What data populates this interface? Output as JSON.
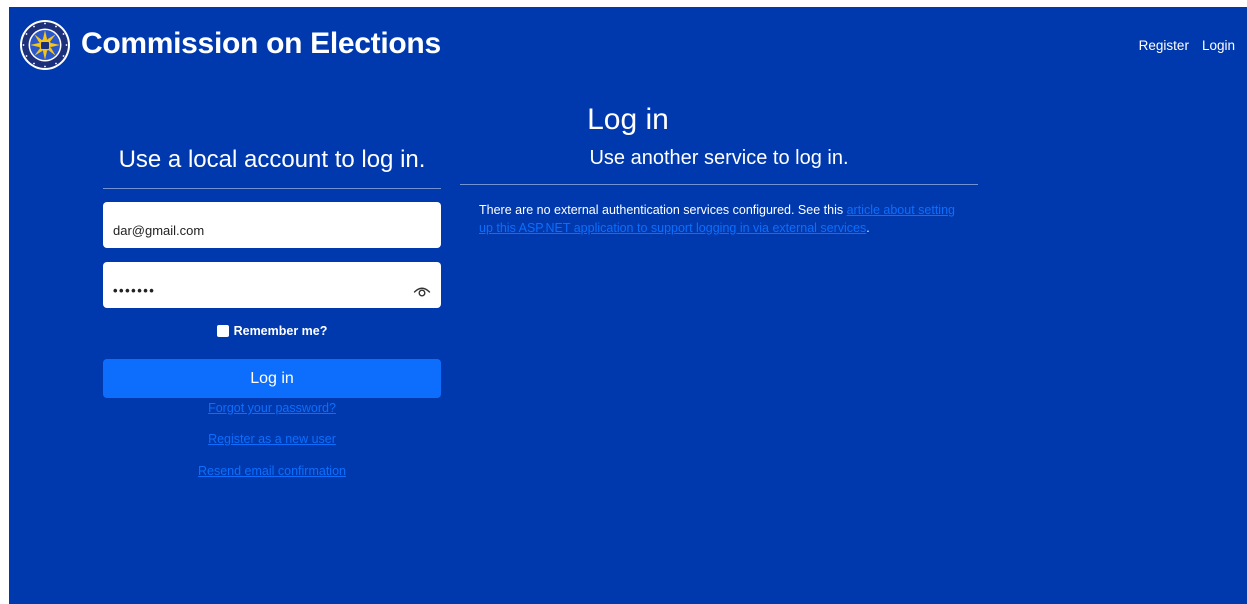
{
  "navbar": {
    "brand_title": "Commission on Elections",
    "links": [
      {
        "label": "Register"
      },
      {
        "label": "Login"
      }
    ]
  },
  "page": {
    "title": "Log in"
  },
  "local_login": {
    "heading": "Use a local account to log in.",
    "email_value": "dar@gmail.com",
    "password_value": "•••••••",
    "remember_label": "Remember me?",
    "login_button": "Log in",
    "forgot_link": "Forgot your password?",
    "register_link": "Register as a new user",
    "resend_link": "Resend email confirmation"
  },
  "external_login": {
    "heading": "Use another service to log in.",
    "text_before": "There are no external authentication services configured. See this ",
    "link_text": "article about setting up this ASP.NET application to support logging in via external services",
    "text_after": "."
  },
  "colors": {
    "background": "#0039ad",
    "primary_button": "#0d6efd",
    "link": "#0d6efd",
    "text": "#ffffff"
  },
  "icons": {
    "logo": "comelec-seal-logo",
    "password_toggle": "eye-icon"
  }
}
